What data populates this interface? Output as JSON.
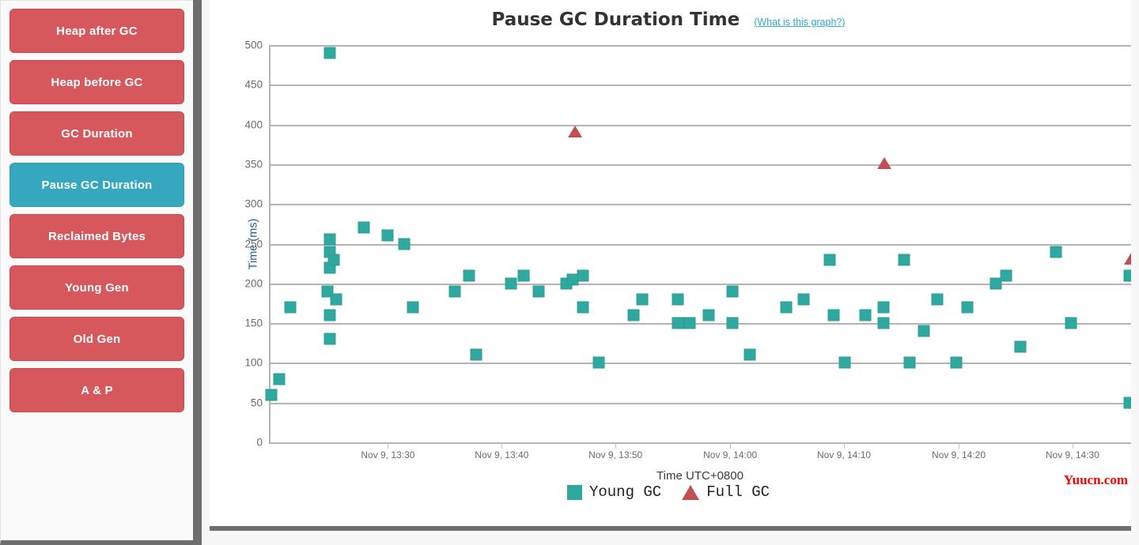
{
  "sidebar": {
    "items": [
      {
        "label": "Heap after GC",
        "active": false
      },
      {
        "label": "Heap before GC",
        "active": false
      },
      {
        "label": "GC Duration",
        "active": false
      },
      {
        "label": "Pause GC Duration",
        "active": true
      },
      {
        "label": "Reclaimed Bytes",
        "active": false
      },
      {
        "label": "Young Gen",
        "active": false
      },
      {
        "label": "Old Gen",
        "active": false
      },
      {
        "label": "A & P",
        "active": false
      }
    ],
    "active_color": "#35a8c0",
    "button_color": "#d6585c"
  },
  "header": {
    "title": "Pause GC Duration Time",
    "help_link": "(What is this graph?)",
    "help_link_color": "#2fa8d0"
  },
  "watermark": "Yuucn.com",
  "chart_data": {
    "type": "scatter",
    "title": "Pause GC Duration Time",
    "xlabel": "Time UTC+0800",
    "ylabel": "Time (ms)",
    "ylim": [
      0,
      500
    ],
    "yticks": [
      0,
      50,
      100,
      150,
      200,
      250,
      300,
      350,
      400,
      450,
      500
    ],
    "grid": true,
    "legend_position": "bottom",
    "xtick_labels": [
      "Nov 9, 13:30",
      "Nov 9, 13:40",
      "Nov 9, 13:50",
      "Nov 9, 14:00",
      "Nov 9, 14:10",
      "Nov 9, 14:20",
      "Nov 9, 14:30"
    ],
    "xtick_positions": [
      0.138,
      0.27,
      0.402,
      0.535,
      0.667,
      0.8,
      0.932
    ],
    "xlim_label": "13:26 to 14:34 (UTC+0800)",
    "series": [
      {
        "name": "Young GC",
        "marker": "square",
        "color": "#2fa8a0",
        "points": [
          {
            "x": 0.003,
            "y": 60
          },
          {
            "x": 0.012,
            "y": 80
          },
          {
            "x": 0.025,
            "y": 170
          },
          {
            "x": 0.071,
            "y": 490
          },
          {
            "x": 0.071,
            "y": 255
          },
          {
            "x": 0.071,
            "y": 240
          },
          {
            "x": 0.071,
            "y": 220
          },
          {
            "x": 0.075,
            "y": 230
          },
          {
            "x": 0.068,
            "y": 190
          },
          {
            "x": 0.078,
            "y": 180
          },
          {
            "x": 0.071,
            "y": 160
          },
          {
            "x": 0.071,
            "y": 130
          },
          {
            "x": 0.11,
            "y": 270
          },
          {
            "x": 0.138,
            "y": 260
          },
          {
            "x": 0.157,
            "y": 250
          },
          {
            "x": 0.167,
            "y": 170
          },
          {
            "x": 0.24,
            "y": 110
          },
          {
            "x": 0.216,
            "y": 190
          },
          {
            "x": 0.232,
            "y": 210
          },
          {
            "x": 0.281,
            "y": 200
          },
          {
            "x": 0.295,
            "y": 210
          },
          {
            "x": 0.313,
            "y": 190
          },
          {
            "x": 0.345,
            "y": 200
          },
          {
            "x": 0.352,
            "y": 205
          },
          {
            "x": 0.364,
            "y": 210
          },
          {
            "x": 0.364,
            "y": 170
          },
          {
            "x": 0.383,
            "y": 100
          },
          {
            "x": 0.423,
            "y": 160
          },
          {
            "x": 0.433,
            "y": 180
          },
          {
            "x": 0.474,
            "y": 180
          },
          {
            "x": 0.474,
            "y": 150
          },
          {
            "x": 0.488,
            "y": 150
          },
          {
            "x": 0.51,
            "y": 160
          },
          {
            "x": 0.538,
            "y": 190
          },
          {
            "x": 0.538,
            "y": 150
          },
          {
            "x": 0.558,
            "y": 110
          },
          {
            "x": 0.6,
            "y": 170
          },
          {
            "x": 0.62,
            "y": 180
          },
          {
            "x": 0.65,
            "y": 230
          },
          {
            "x": 0.655,
            "y": 160
          },
          {
            "x": 0.668,
            "y": 100
          },
          {
            "x": 0.692,
            "y": 160
          },
          {
            "x": 0.713,
            "y": 170
          },
          {
            "x": 0.713,
            "y": 150
          },
          {
            "x": 0.737,
            "y": 230
          },
          {
            "x": 0.743,
            "y": 100
          },
          {
            "x": 0.76,
            "y": 140
          },
          {
            "x": 0.775,
            "y": 180
          },
          {
            "x": 0.797,
            "y": 100
          },
          {
            "x": 0.81,
            "y": 170
          },
          {
            "x": 0.843,
            "y": 200
          },
          {
            "x": 0.855,
            "y": 210
          },
          {
            "x": 0.872,
            "y": 120
          },
          {
            "x": 0.913,
            "y": 240
          },
          {
            "x": 0.93,
            "y": 150
          },
          {
            "x": 0.998,
            "y": 210
          },
          {
            "x": 0.998,
            "y": 50
          }
        ]
      },
      {
        "name": "Full GC",
        "marker": "triangle",
        "color": "#bf5154",
        "points": [
          {
            "x": 0.355,
            "y": 390
          },
          {
            "x": 0.714,
            "y": 350
          },
          {
            "x": 1.0,
            "y": 230
          }
        ]
      }
    ]
  },
  "legend": [
    {
      "label": "Young GC",
      "marker": "square"
    },
    {
      "label": "Full GC",
      "marker": "triangle"
    }
  ]
}
